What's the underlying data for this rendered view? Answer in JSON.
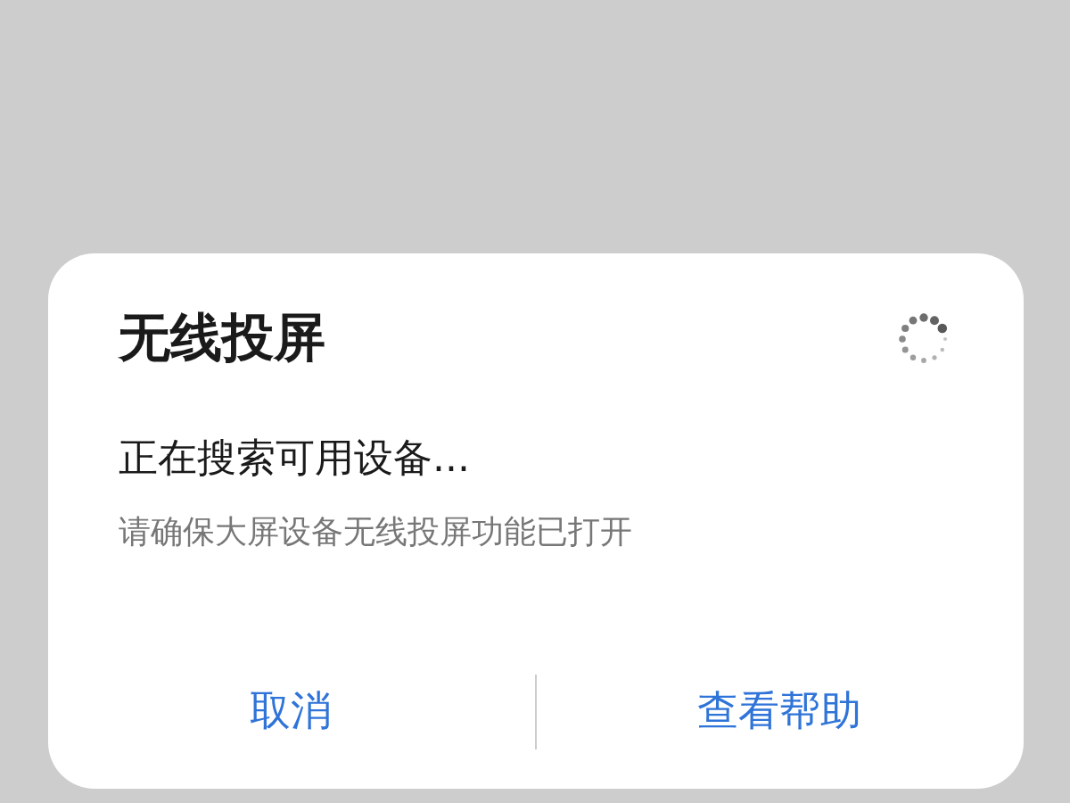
{
  "dialog": {
    "title": "无线投屏",
    "status": "正在搜索可用设备...",
    "hint": "请确保大屏设备无线投屏功能已打开",
    "buttons": [
      "取消",
      "查看帮助"
    ]
  }
}
